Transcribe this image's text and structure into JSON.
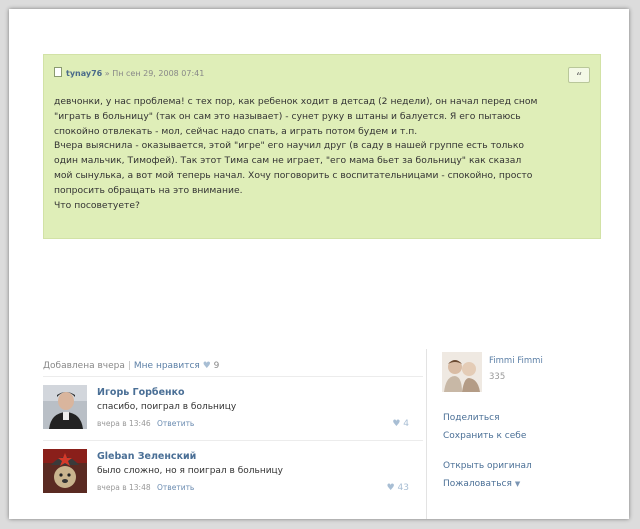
{
  "post": {
    "author": "tynay76",
    "separator": "»",
    "date": "Пн сен 29, 2008 07:41",
    "quote_icon": "quote-icon",
    "lines": [
      "девчонки, у нас проблема! с тех пор, как ребенок ходит в детсад (2 недели), он начал перед сном",
      "\"играть в больницу\" (так он сам это называет) - сунет руку в штаны и балуется. Я его пытаюсь",
      "спокойно отвлекать - мол, сейчас надо спать, а играть потом будем и т.п.",
      "Вчера выяснила - оказывается, этой \"игре\" его научил друг (в саду в нашей группе есть только",
      "один мальчик, Тимофей). Так этот Тима сам не играет, \"его мама бьет за больницу\" как сказал",
      "мой сынулька, а вот мой теперь начал. Хочу поговорить с воспитательницами - спокойно, просто",
      "попросить обращать на это внимание.",
      "Что посоветуете?"
    ]
  },
  "meta": {
    "added": "Добавлена вчера",
    "divider": "|",
    "like_label": "Мне нравится",
    "like_icon": "heart-icon",
    "like_count": "9"
  },
  "comments": [
    {
      "name": "Игорь Горбенко",
      "text": "спасибо, поиграл в больницу",
      "time": "вчера в 13:46",
      "reply": "Ответить",
      "likes": "4"
    },
    {
      "name": "Gleban Зеленский",
      "text": "было сложно, но я поиграл в больницу",
      "time": "вчера в 13:48",
      "reply": "Ответить",
      "likes": "43"
    }
  ],
  "sidebar": {
    "name": "Fimmi Fimmi",
    "count": "335",
    "share": "Поделиться",
    "save": "Сохранить к себе",
    "open": "Открыть оригинал",
    "report": "Пожаловаться",
    "report_caret": "▼"
  },
  "colors": {
    "post_bg": "#dfeeb8",
    "link": "#4a6f96"
  }
}
